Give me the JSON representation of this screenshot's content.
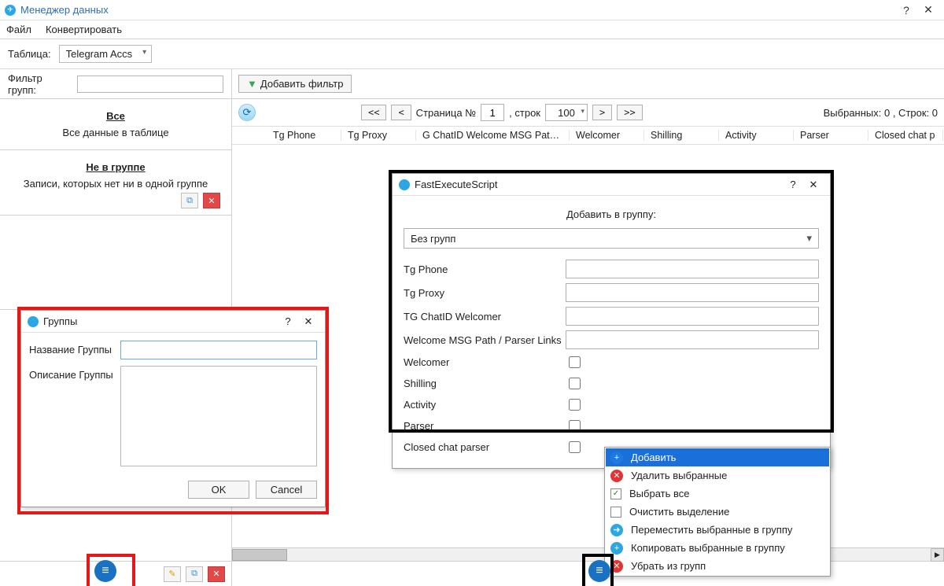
{
  "window": {
    "title": "Менеджер данных"
  },
  "menubar": {
    "file": "Файл",
    "convert": "Конвертировать"
  },
  "tablebar": {
    "label": "Таблица:",
    "selected": "Telegram Accs"
  },
  "filter": {
    "label": "Фильтр групп:",
    "value": ""
  },
  "groups": [
    {
      "title": "Все",
      "desc": "Все данные в таблице"
    },
    {
      "title": "Не в группе",
      "desc": "Записи, которых нет ни в одной группе"
    }
  ],
  "addFilterBtn": "Добавить фильтр",
  "pager": {
    "first": "<<",
    "prev": "<",
    "next": ">",
    "last": ">>",
    "pageLabelPre": "Страница №",
    "page": "1",
    "rowsLabel": ", строк",
    "rows": "100",
    "stats": "Выбранных:  0 ,  Строк:  0"
  },
  "columns": [
    "Tg Phone",
    "Tg Proxy",
    "G ChatID Welcome MSG Path / Par",
    "Welcomer",
    "Shilling",
    "Activity",
    "Parser",
    "Closed chat p"
  ],
  "groupsDialog": {
    "title": "Группы",
    "nameLabel": "Название Группы",
    "descLabel": "Описание Группы",
    "ok": "OK",
    "cancel": "Cancel"
  },
  "fesDialog": {
    "title": "FastExecuteScript",
    "addToGroup": "Добавить в группу:",
    "ddValue": "Без групп",
    "fields": {
      "phone": "Tg Phone",
      "proxy": "Tg Proxy",
      "chatid": "TG ChatID Welcomer",
      "msgpath": "Welcome MSG Path / Parser Links",
      "welcomer": "Welcomer",
      "shilling": "Shilling",
      "activity": "Activity",
      "parser": "Parser",
      "closed": "Closed chat parser"
    }
  },
  "ctx": {
    "add": "Добавить",
    "delSel": "Удалить выбранные",
    "selAll": "Выбрать все",
    "clearSel": "Очистить выделение",
    "moveToGroup": "Переместить выбранные в группу",
    "copyToGroup": "Копировать выбранные в группу",
    "removeFromGroups": "Убрать из групп"
  }
}
